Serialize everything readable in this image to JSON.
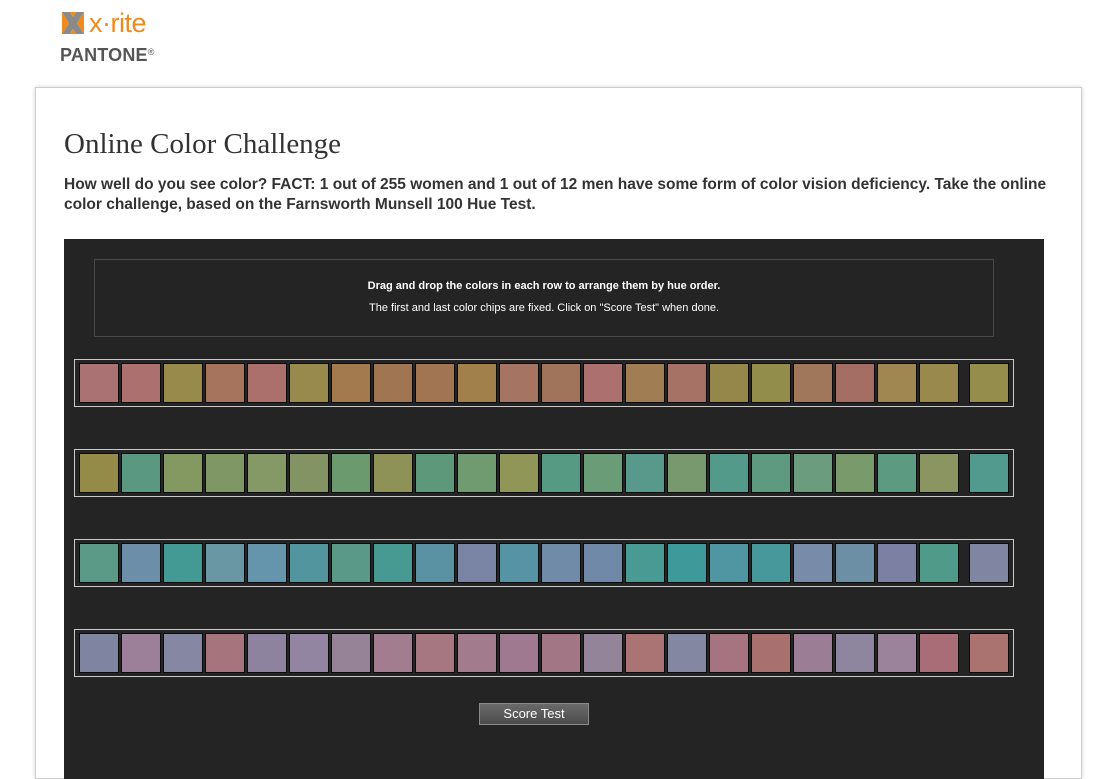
{
  "brand": {
    "name": "x·rite",
    "sub": "PANTONE",
    "sub_mark": "®",
    "accent": "#f08a1c"
  },
  "page": {
    "title": "Online Color Challenge",
    "intro": "How well do you see color? FACT: 1 out of 255 women and 1 out of 12 men have some form of color vision deficiency. Take the online color challenge, based on the Farnsworth Munsell 100 Hue Test."
  },
  "game": {
    "instruction_1": "Drag and drop the colors in each row to arrange them by hue order.",
    "instruction_2": "The first and last color chips are fixed. Click on \"Score Test\" when done.",
    "score_button": "Score Test",
    "rows": [
      [
        "#ab7273",
        "#ac716e",
        "#978a4b",
        "#a6735c",
        "#ac706c",
        "#988a4c",
        "#a37a4d",
        "#a07552",
        "#a27552",
        "#a2804b",
        "#a57462",
        "#a0745b",
        "#ac716e",
        "#a07d52",
        "#a67265",
        "#95874a",
        "#928d4b",
        "#a0775a",
        "#a46e65",
        "#a08651",
        "#99894d",
        "#958d4b"
      ],
      [
        "#948b48",
        "#5a9882",
        "#849962",
        "#7f9665",
        "#849965",
        "#849363",
        "#6b9a6e",
        "#8f9257",
        "#5c9879",
        "#709b70",
        "#8f9658",
        "#569a83",
        "#6a9c77",
        "#58998b",
        "#78996e",
        "#539a8b",
        "#5e9a80",
        "#6c9c7e",
        "#799a6a",
        "#5c9a82",
        "#8b9561",
        "#529a8e"
      ],
      [
        "#5c9a88",
        "#6c8ea9",
        "#439a94",
        "#6997a4",
        "#6595ac",
        "#52959f",
        "#5a9887",
        "#479a91",
        "#5a92a3",
        "#7a85a5",
        "#5693a4",
        "#708ba8",
        "#7089a9",
        "#499a92",
        "#3e9a9a",
        "#5095a2",
        "#46989a",
        "#788ba8",
        "#6c8fa5",
        "#7c80a3",
        "#4f9a89",
        "#8085a2"
      ],
      [
        "#7f85a0",
        "#9c809a",
        "#8687a2",
        "#a5747d",
        "#8d839f",
        "#9285a1",
        "#978397",
        "#a17d8f",
        "#a67681",
        "#a27b8d",
        "#9e7990",
        "#a37686",
        "#938499",
        "#aa7474",
        "#8387a2",
        "#a57480",
        "#a8706e",
        "#9b7e96",
        "#8e859f",
        "#9a839b",
        "#a86d76",
        "#aa736f"
      ]
    ]
  }
}
